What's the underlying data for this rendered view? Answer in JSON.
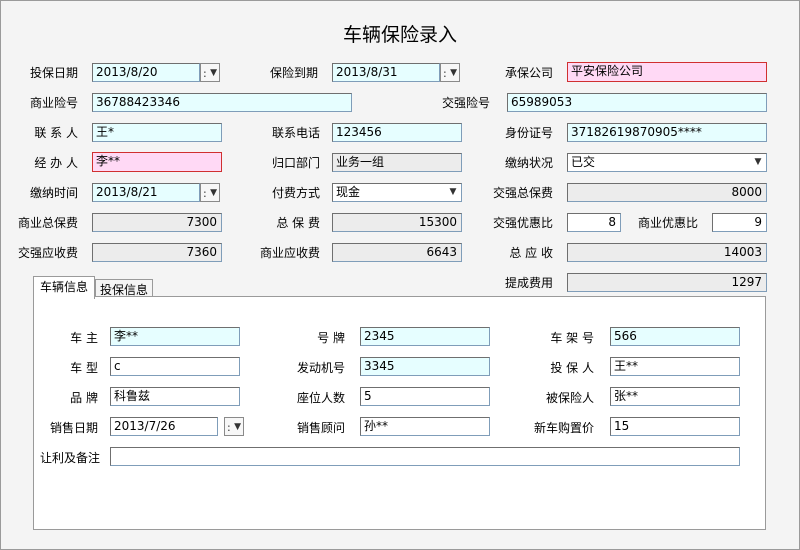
{
  "title": "车辆保险录入",
  "top": {
    "start_date": {
      "label": "投保日期",
      "value": "2013/8/20"
    },
    "end_date": {
      "label": "保险到期",
      "value": "2013/8/31"
    },
    "insurer": {
      "label": "承保公司",
      "value": "平安保险公司"
    },
    "commercial_policy_no": {
      "label": "商业险号",
      "value": "36788423346"
    },
    "compulsory_policy_no": {
      "label": "交强险号",
      "value": "65989053"
    },
    "contact": {
      "label": "联 系 人",
      "value": "王*"
    },
    "phone": {
      "label": "联系电话",
      "value": "123456"
    },
    "id_no": {
      "label": "身份证号",
      "value": "37182619870905****"
    },
    "handler": {
      "label": "经 办 人",
      "value": "李**"
    },
    "department": {
      "label": "归口部门",
      "value": "业务一组"
    },
    "payment_status": {
      "label": "缴纳状况",
      "value": "已交"
    },
    "payment_time": {
      "label": "缴纳时间",
      "value": "2013/8/21"
    },
    "payment_method": {
      "label": "付费方式",
      "value": "现金"
    },
    "compulsory_total_premium": {
      "label": "交强总保费",
      "value": "8000"
    },
    "commercial_total_premium": {
      "label": "商业总保费",
      "value": "7300"
    },
    "total_premium": {
      "label": "总 保 费",
      "value": "15300"
    },
    "compulsory_discount": {
      "label": "交强优惠比",
      "value": "8"
    },
    "commercial_discount": {
      "label": "商业优惠比",
      "value": "9"
    },
    "compulsory_receivable": {
      "label": "交强应收费",
      "value": "7360"
    },
    "commercial_receivable": {
      "label": "商业应收费",
      "value": "6643"
    },
    "total_receivable": {
      "label": "总 应 收",
      "value": "14003"
    },
    "commission": {
      "label": "提成费用",
      "value": "1297"
    }
  },
  "tabs": [
    {
      "label": "车辆信息",
      "active": true
    },
    {
      "label": "投保信息",
      "active": false
    }
  ],
  "vehicle": {
    "owner": {
      "label": "车    主",
      "value": "李**"
    },
    "plate": {
      "label": "号    牌",
      "value": "2345"
    },
    "vin": {
      "label": "车 架 号",
      "value": "566"
    },
    "model": {
      "label": "车    型",
      "value": "c"
    },
    "engine_no": {
      "label": "发动机号",
      "value": "3345"
    },
    "policyholder": {
      "label": "投 保 人",
      "value": "王**"
    },
    "brand": {
      "label": "品    牌",
      "value": "科鲁兹"
    },
    "seats": {
      "label": "座位人数",
      "value": "5"
    },
    "insured": {
      "label": "被保险人",
      "value": "张**"
    },
    "sale_date": {
      "label": "销售日期",
      "value": "2013/7/26"
    },
    "sales_consultant": {
      "label": "销售顾问",
      "value": "孙**"
    },
    "new_car_price": {
      "label": "新车购置价",
      "value": "15"
    },
    "remarks": {
      "label": "让利及备注",
      "value": ""
    }
  },
  "colors": {
    "field_cyan": "#e6feff",
    "field_pink": "#ffd9f5",
    "field_gray": "#ececec",
    "pink_border": "#d03030"
  }
}
